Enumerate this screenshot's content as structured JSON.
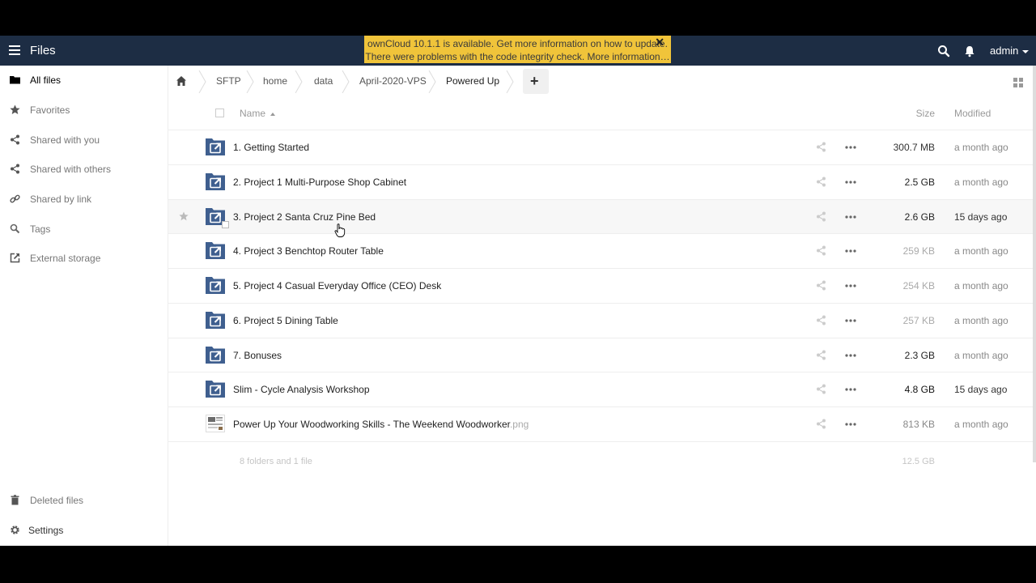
{
  "header": {
    "app_title": "Files",
    "user_label": "admin"
  },
  "notification": {
    "line1": "ownCloud 10.1.1 is available. Get more information on how to update.",
    "line2": "There were problems with the code integrity check. More information…",
    "close": "✕"
  },
  "sidebar": {
    "items": [
      {
        "label": "All files",
        "icon": "folder-icon",
        "active": true
      },
      {
        "label": "Favorites",
        "icon": "star-icon"
      },
      {
        "label": "Shared with you",
        "icon": "share-icon"
      },
      {
        "label": "Shared with others",
        "icon": "share-icon"
      },
      {
        "label": "Shared by link",
        "icon": "link-icon"
      },
      {
        "label": "Tags",
        "icon": "tag-icon"
      },
      {
        "label": "External storage",
        "icon": "external-icon"
      }
    ],
    "deleted_files": "Deleted files",
    "settings": "Settings"
  },
  "breadcrumb": {
    "items": [
      "SFTP",
      "home",
      "data",
      "April-2020-VPS",
      "Powered Up"
    ],
    "add_label": "+"
  },
  "table": {
    "col_name": "Name",
    "col_size": "Size",
    "col_modified": "Modified"
  },
  "files": [
    {
      "name": "1. Getting Started",
      "ext": "",
      "size": "300.7 MB",
      "modified": "a month ago",
      "type": "folder",
      "size_color": "#333",
      "mod_color": "#888"
    },
    {
      "name": "2. Project 1 Multi-Purpose Shop Cabinet",
      "ext": "",
      "size": "2.5 GB",
      "modified": "a month ago",
      "type": "folder",
      "size_color": "#222",
      "mod_color": "#888"
    },
    {
      "name": "3. Project 2 Santa Cruz Pine Bed",
      "ext": "",
      "size": "2.6 GB",
      "modified": "15 days ago",
      "type": "folder",
      "size_color": "#222",
      "mod_color": "#333"
    },
    {
      "name": "4. Project 3 Benchtop Router Table",
      "ext": "",
      "size": "259 KB",
      "modified": "a month ago",
      "type": "folder",
      "size_color": "#aaa",
      "mod_color": "#888"
    },
    {
      "name": "5. Project 4 Casual Everyday Office (CEO) Desk",
      "ext": "",
      "size": "254 KB",
      "modified": "a month ago",
      "type": "folder",
      "size_color": "#aaa",
      "mod_color": "#888"
    },
    {
      "name": "6. Project 5 Dining Table",
      "ext": "",
      "size": "257 KB",
      "modified": "a month ago",
      "type": "folder",
      "size_color": "#aaa",
      "mod_color": "#888"
    },
    {
      "name": "7. Bonuses",
      "ext": "",
      "size": "2.3 GB",
      "modified": "a month ago",
      "type": "folder",
      "size_color": "#222",
      "mod_color": "#888"
    },
    {
      "name": "Slim - Cycle Analysis Workshop",
      "ext": "",
      "size": "4.8 GB",
      "modified": "15 days ago",
      "type": "folder",
      "size_color": "#111",
      "mod_color": "#333"
    },
    {
      "name": "Power Up Your Woodworking Skills - The Weekend Woodworker",
      "ext": ".png",
      "size": "813 KB",
      "modified": "a month ago",
      "type": "image",
      "size_color": "#888",
      "mod_color": "#888"
    }
  ],
  "summary": {
    "text": "8 folders and 1 file",
    "size": "12.5 GB"
  },
  "colors": {
    "header_bg": "#1d2d44",
    "notification_bg": "#f0c43a",
    "folder_blue": "#3f5f8f"
  }
}
